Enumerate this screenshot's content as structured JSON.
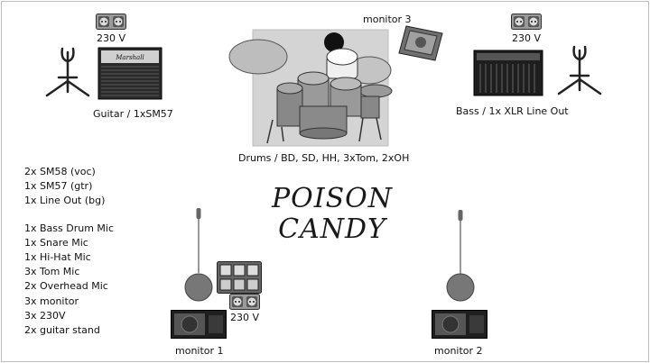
{
  "icons": {
    "power_outlet": "power-outlet-icon",
    "guitar_amp": "guitar-amp-icon",
    "bass_amp": "bass-amp-icon",
    "guitar_stand": "guitar-stand-icon",
    "drum_kit": "drum-kit-icon",
    "monitor_wedge": "monitor-wedge-icon",
    "mic_stand": "mic-stand-icon",
    "pedalboard": "pedalboard-icon"
  },
  "power_labels": [
    "230 V",
    "230 V",
    "230 V"
  ],
  "guitar": {
    "label": "Guitar / 1xSM57",
    "amp_brand": "Marshall"
  },
  "bass": {
    "label": "Bass / 1x XLR Line Out"
  },
  "drums": {
    "label": "Drums / BD, SD, HH, 3xTom, 2xOH"
  },
  "monitors": {
    "m1": "monitor 1",
    "m2": "monitor 2",
    "m3": "monitor 3"
  },
  "logo": {
    "line1": "POISON",
    "line2": "CANDY"
  },
  "equipment_list": {
    "group1": [
      "2x SM58 (voc)",
      "1x SM57 (gtr)",
      "1x Line Out (bg)"
    ],
    "group2": [
      "1x Bass Drum Mic",
      "1x Snare Mic",
      "1x Hi-Hat Mic",
      "3x Tom Mic",
      "2x Overhead Mic"
    ],
    "group3": [
      "3x monitor",
      "3x 230V",
      "2x guitar stand"
    ]
  }
}
